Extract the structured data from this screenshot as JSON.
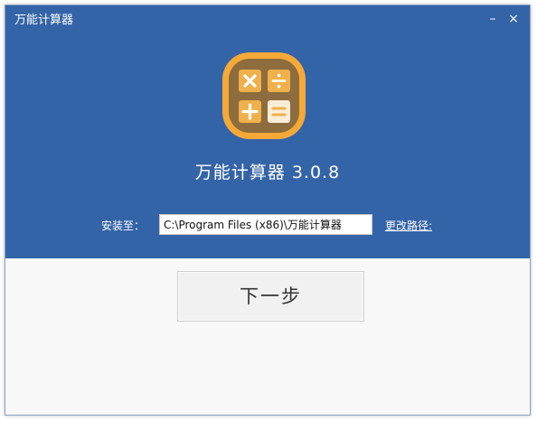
{
  "window": {
    "title": "万能计算器",
    "minimize_glyph": "–",
    "close_glyph": "×"
  },
  "app": {
    "name": "万能计算器 3.0.8",
    "icon": "calculator-icon"
  },
  "install": {
    "label": "安装至：",
    "path": "C:\\Program Files (x86)\\万能计算器",
    "change_path_label": "更改路径:"
  },
  "actions": {
    "next_label": "下一步"
  },
  "colors": {
    "header_bg": "#3464a8",
    "body_bg": "#f8f8f8",
    "logo_outer": "#f6a937",
    "logo_inner": "#8d6c3e",
    "tile_orange": "#f0b04b",
    "tile_cream": "#f9edd7"
  }
}
